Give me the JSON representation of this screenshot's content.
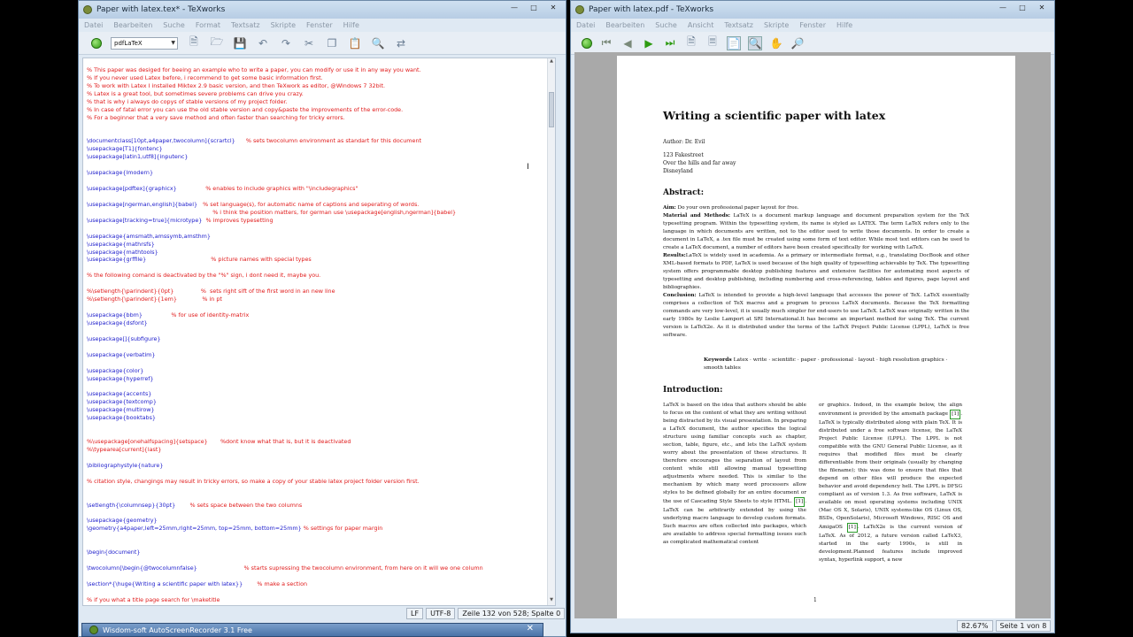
{
  "left_window": {
    "title": "Paper with latex.tex* - TeXworks",
    "menu": [
      "Datei",
      "Bearbeiten",
      "Suche",
      "Format",
      "Textsatz",
      "Skripte",
      "Fenster",
      "Hilfe"
    ],
    "engine": "pdfLaTeX",
    "code_lines": [
      {
        "t": ""
      },
      {
        "c": "cmt",
        "t": "% This paper was desiged for beeing an example who to write a paper, you can modify or use it in any way you want."
      },
      {
        "c": "cmt",
        "t": "% If you never used Latex before, i recommend to get some basic information first."
      },
      {
        "c": "cmt",
        "t": "% To work with Latex I installed Miktex 2.9 basic version, and then TeXwork as editor, @Windows 7 32bit."
      },
      {
        "c": "cmt",
        "t": "% Latex is a great tool, but sometimes severe problems can drive you crazy."
      },
      {
        "c": "cmt",
        "t": "% that is why i always do copys of stable versions of my project folder."
      },
      {
        "c": "cmt",
        "t": "% In case of fatal error you can use the old stable version and copy&paste the improvements of the error-code."
      },
      {
        "c": "cmt",
        "t": "% For a beginner that a very save method and often faster than searching for tricky errors."
      },
      {
        "t": ""
      },
      {
        "t": ""
      },
      {
        "c": "cmd",
        "t": "\\documentclass[10pt,a4paper,twocolumn]{scrartcl}",
        "m": "      % sets twocolumn environment as standart for this document"
      },
      {
        "c": "cmd",
        "t": "\\usepackage[T1]{fontenc}"
      },
      {
        "c": "cmd",
        "t": "\\usepackage[latin1,utf8]{inputenc}"
      },
      {
        "t": ""
      },
      {
        "c": "cmd",
        "t": "\\usepackage{lmodern}"
      },
      {
        "t": ""
      },
      {
        "c": "cmd",
        "t": "\\usepackage[pdftex]{graphicx}",
        "m": "                % enables to include graphics with \"\\includegraphics\""
      },
      {
        "t": ""
      },
      {
        "c": "cmd",
        "t": "\\usepackage[ngerman,english]{babel}",
        "m": "   % set language(s), for automatic name of captions and seperating of words."
      },
      {
        "c": "cmt",
        "t": "                                                                      % i think the position matters, for german use \\usepackage[english,ngerman]{babel}"
      },
      {
        "c": "cmd",
        "t": "\\usepackage[tracking=true]{microtype}",
        "m": "  % improves typesetting"
      },
      {
        "t": ""
      },
      {
        "c": "cmd",
        "t": "\\usepackage{amsmath,amssymb,amsthm}"
      },
      {
        "c": "cmd",
        "t": "\\usepackage{mathrsfs}"
      },
      {
        "c": "cmd",
        "t": "\\usepackage{mathtools}"
      },
      {
        "c": "cmd",
        "t": "\\usepackage{grffile}",
        "m": "                                    % picture names with special types"
      },
      {
        "t": ""
      },
      {
        "c": "cmt",
        "t": "% the following comand is deactivated by the \"%\" sign, i dont need it, maybe you."
      },
      {
        "t": ""
      },
      {
        "c": "cmt",
        "t": "%\\setlength{\\parindent}{0pt}               %  sets right sift of the first word in an new line"
      },
      {
        "c": "cmt",
        "t": "%\\setlength{\\parindent}{1em}              % in pt"
      },
      {
        "t": ""
      },
      {
        "c": "cmd",
        "t": "\\usepackage{bbm}",
        "m": "                % for use of identity-matrix"
      },
      {
        "c": "cmd",
        "t": "\\usepackage{dsfont}"
      },
      {
        "t": ""
      },
      {
        "c": "cmd",
        "t": "\\usepackage[]{subfigure}"
      },
      {
        "t": ""
      },
      {
        "c": "cmd",
        "t": "\\usepackage{verbatim}"
      },
      {
        "t": ""
      },
      {
        "c": "cmd",
        "t": "\\usepackage{color}"
      },
      {
        "c": "cmd",
        "t": "\\usepackage{hyperref}"
      },
      {
        "t": ""
      },
      {
        "c": "cmd",
        "t": "\\usepackage{accents}"
      },
      {
        "c": "cmd",
        "t": "\\usepackage{textcomp}"
      },
      {
        "c": "cmd",
        "t": "\\usepackage{multirow}"
      },
      {
        "c": "cmd",
        "t": "\\usepackage{booktabs}"
      },
      {
        "t": ""
      },
      {
        "t": ""
      },
      {
        "c": "cmt",
        "t": "%\\usepackage[onehalfspacing]{setspace}       %dont know what that is, but it is deactivated"
      },
      {
        "c": "cmt",
        "t": "%\\typearea[current]{last}"
      },
      {
        "t": ""
      },
      {
        "c": "cmd",
        "t": "\\bibliographystyle{nature}"
      },
      {
        "t": ""
      },
      {
        "c": "cmt",
        "t": "% citation style, changings may result in tricky errors, so make a copy of your stable latex project folder version first."
      },
      {
        "t": ""
      },
      {
        "t": ""
      },
      {
        "c": "cmd",
        "t": "\\setlength{\\columnsep}{30pt}",
        "m": "        % sets space between the two columns"
      },
      {
        "t": ""
      },
      {
        "c": "cmd",
        "t": "\\usepackage{geometry}"
      },
      {
        "c": "cmd",
        "t": "\\geometry{a4paper,left=25mm,right=25mm, top=25mm, bottom=25mm}",
        "m": " % settings for paper margin"
      },
      {
        "t": ""
      },
      {
        "t": ""
      },
      {
        "c": "cmd",
        "t": "\\begin{document}"
      },
      {
        "t": ""
      },
      {
        "c": "cmd",
        "t": "\\twocolumn[\\begin{@twocolumnfalse}",
        "m": "                          % starts supressing the twocolumn environment, from here on it will we one column"
      },
      {
        "t": ""
      },
      {
        "c": "cmd",
        "t": "\\section*{\\huge{Writing a scientific paper with latex}}",
        "m": "        % make a section"
      },
      {
        "t": ""
      },
      {
        "c": "cmt",
        "t": "% if you what a title page search for \\maketitle"
      }
    ],
    "status": {
      "eol": "LF",
      "encoding": "UTF-8",
      "position": "Zeile 132 von 528; Spalte 0"
    }
  },
  "right_window": {
    "title": "Paper with latex.pdf - TeXworks",
    "menu": [
      "Datei",
      "Bearbeiten",
      "Suche",
      "Ansicht",
      "Textsatz",
      "Skripte",
      "Fenster",
      "Hilfe"
    ],
    "page": {
      "title": "Writing a scientific paper with latex",
      "author": "Author: Dr. Evil",
      "address": [
        "123 Fakestreet",
        "Over the hills and far away",
        "Disneyland"
      ],
      "abstract_heading": "Abstract:",
      "aim_label": "Aim:",
      "aim_text": "Do your own professional paper layout for free.",
      "methods_label": "Material and Methods:",
      "methods_text": "LaTeX is a document markup language and document preparation system for the TeX typesetting program. Within the typesetting system, its name is styled as LATEX. The term LaTeX refers only to the language in which documents are written, not to the editor used to write those documents. In order to create a document in LaTeX, a .tex file must be created using some form of text editor. While most text editors can be used to create a LaTeX document, a number of editors have been created specifically for working with LaTeX.",
      "results_label": "Results:",
      "results_text": "LaTeX is widely used in academia. As a primary or intermediate format, e.g., translating DocBook and other XML-based formats to PDF, LaTeX is used because of the high quality of typesetting achievable by TeX. The typesetting system offers programmable desktop publishing features and extensive facilities for automating most aspects of typesetting and desktop publishing, including numbering and cross-referencing, tables and figures, page layout and bibliographies.",
      "conclusion_label": "Conclusion:",
      "conclusion_text": "LaTeX is intended to provide a high-level language that accesses the power of TeX. LaTeX essentially comprises a collection of TeX macros and a program to process LaTeX documents. Because the TeX formatting commands are very low-level, it is usually much simpler for end-users to use LaTeX. LaTeX was originally written in the early 1980s by Leslie Lamport at SRI International.It has become an important method for using TeX. The current version is LaTeX2e. As it is distributed under the terms of the LaTeX Project Public License (LPPL), LaTeX is free software.",
      "keywords_label": "Keywords",
      "keywords_text": "Latex · write · scientific · paper · professional · layout · high resolution graphics · smooth tables",
      "intro_heading": "Introduction:",
      "col1": "LaTeX is based on the idea that authors should be able to focus on the content of what they are writing without being distracted by its visual presentation. In preparing a LaTeX document, the author specifies the logical structure using familiar concepts such as chapter, section, table, figure, etc., and lets the LaTeX system worry about the presentation of these structures. It therefore encourages the separation of layout from content while still allowing manual typesetting adjustments where needed. This is similar to the mechanism by which many word processors allow styles to be defined globally for an entire document or the use of Cascading Style Sheets to style HTML.",
      "col1_ref": "[1]",
      "col1_tail": ". LaTeX can be arbitrarily extended by using the underlying macro language to develop custom formats. Such macros are often collected into packages, which are available to address special formatting issues such as complicated mathematical content",
      "col2_a": "or graphics. Indeed, in the example below, the align environment is provided by the amsmath package",
      "col2_ref1": "[1]",
      "col2_b": ". LaTeX is typically distributed along with plain TeX. It is distributed under a free software license, the LaTeX Project Public License (LPPL). The LPPL is not compatible with the GNU General Public License, as it requires that modified files must be clearly differentiable from their originals (usually by changing the filename); this was done to ensure that files that depend on other files will produce the expected behavior and avoid dependency hell. The LPPL is DFSG compliant as of version 1.3. As free software, LaTeX is available on most operating systems including UNIX (Mac OS X, Solaris), UNIX systems-like OS (Linux OS, BSDs, OpenSolaris), Microsoft Windows, RISC OS and AmigaOS",
      "col2_ref2": "[1]",
      "col2_c": ". LaTeX2e is the current version of LaTeX. As of 2012, a future version called LaTeX3, started in the early 1990s, is still in development.Planned features include improved syntax, hyperlink support, a new",
      "page_number": "1"
    },
    "status": {
      "zoom": "82.67%",
      "page": "Seite 1 von 8"
    }
  },
  "taskbar": {
    "label": "Wisdom-soft AutoScreenRecorder 3.1 Free"
  }
}
